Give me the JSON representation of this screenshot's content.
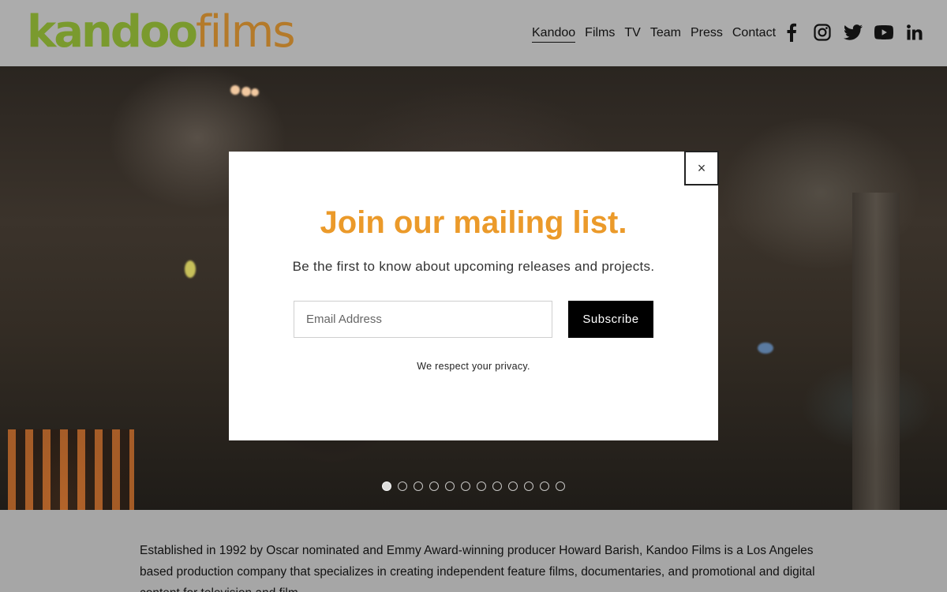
{
  "brand": {
    "logo_part1": "kandoo",
    "logo_part2": "films"
  },
  "nav": {
    "items": [
      {
        "label": "Kandoo",
        "active": true
      },
      {
        "label": "Films"
      },
      {
        "label": "TV"
      },
      {
        "label": "Team"
      },
      {
        "label": "Press"
      },
      {
        "label": "Contact"
      }
    ]
  },
  "socials": [
    "facebook-icon",
    "instagram-icon",
    "twitter-icon",
    "youtube-icon",
    "linkedin-icon"
  ],
  "carousel": {
    "slide_count": 12,
    "active_index": 0
  },
  "modal": {
    "close_label": "×",
    "title": "Join our mailing list.",
    "subtitle": "Be the first to know about upcoming releases and projects.",
    "email_placeholder": "Email Address",
    "subscribe_label": "Subscribe",
    "privacy": "We respect your privacy."
  },
  "about": {
    "text": "Established in 1992 by Oscar nominated and Emmy Award-winning producer Howard Barish, Kandoo Films is a Los Angeles based production company that specializes in creating independent feature films, documentaries, and promotional and digital content for television and film."
  },
  "colors": {
    "accent": "#eb9a2a",
    "logo_green": "#7a9a2e",
    "logo_orange": "#b47a2a"
  }
}
